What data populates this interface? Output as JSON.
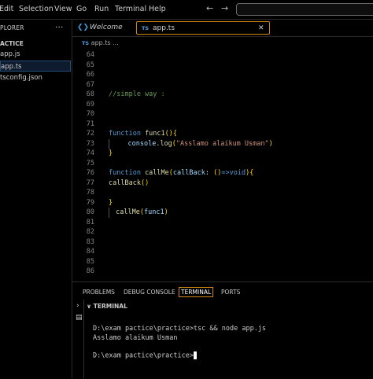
{
  "menubar": {
    "items": [
      "Edit",
      "Selection",
      "View",
      "Go",
      "Run",
      "Terminal",
      "Help"
    ],
    "back_icon": "arrow-left-icon",
    "forward_icon": "arrow-right-icon"
  },
  "explorer": {
    "header": "PLORER",
    "more": "···",
    "folder": "ACTICE",
    "files": [
      {
        "name": "app.js",
        "active": false
      },
      {
        "name": "app.ts",
        "active": true
      },
      {
        "name": "tsconfig.json",
        "active": false
      }
    ]
  },
  "tabs": {
    "welcome": {
      "icon": "vscode-icon",
      "label": "Welcome"
    },
    "app": {
      "icon_text": "TS",
      "label": "app.ts",
      "close": "✕"
    }
  },
  "breadcrumb": {
    "icon_text": "TS",
    "label": "app.ts",
    "more": "..."
  },
  "editor": {
    "lines": [
      {
        "n": "64",
        "tokens": []
      },
      {
        "n": "65",
        "tokens": []
      },
      {
        "n": "66",
        "tokens": []
      },
      {
        "n": "67",
        "tokens": []
      },
      {
        "n": "68",
        "tokens": [
          {
            "t": "//simple way :",
            "c": "comment"
          }
        ]
      },
      {
        "n": "69",
        "tokens": []
      },
      {
        "n": "70",
        "tokens": []
      },
      {
        "n": "71",
        "tokens": []
      },
      {
        "n": "72",
        "tokens": [
          {
            "t": "function ",
            "c": "kw"
          },
          {
            "t": "func1",
            "c": "fn"
          },
          {
            "t": "(){",
            "c": "par"
          }
        ]
      },
      {
        "n": "73",
        "guide": true,
        "tokens": [
          {
            "t": "    ",
            "c": "pl"
          },
          {
            "t": "console",
            "c": "var"
          },
          {
            "t": ".",
            "c": "pl"
          },
          {
            "t": "log",
            "c": "fn"
          },
          {
            "t": "(",
            "c": "par"
          },
          {
            "t": "\"Asslamo alaikum Usman\"",
            "c": "str"
          },
          {
            "t": ")",
            "c": "par"
          }
        ]
      },
      {
        "n": "74",
        "tokens": [
          {
            "t": "}",
            "c": "par"
          }
        ]
      },
      {
        "n": "75",
        "tokens": []
      },
      {
        "n": "76",
        "tokens": [
          {
            "t": "function ",
            "c": "kw"
          },
          {
            "t": "callMe",
            "c": "fn"
          },
          {
            "t": "(",
            "c": "par"
          },
          {
            "t": "callBack",
            "c": "var"
          },
          {
            "t": ": ",
            "c": "pl"
          },
          {
            "t": "()",
            "c": "par"
          },
          {
            "t": "=>",
            "c": "kw"
          },
          {
            "t": "void",
            "c": "kw"
          },
          {
            "t": "){",
            "c": "par"
          }
        ]
      },
      {
        "n": "77",
        "tokens": [
          {
            "t": "callBack",
            "c": "fn"
          },
          {
            "t": "()",
            "c": "par"
          }
        ]
      },
      {
        "n": "78",
        "tokens": []
      },
      {
        "n": "79",
        "tokens": [
          {
            "t": "}",
            "c": "par"
          }
        ]
      },
      {
        "n": "80",
        "guide": true,
        "tokens": [
          {
            "t": " ",
            "c": "pl"
          },
          {
            "t": "callMe",
            "c": "fn"
          },
          {
            "t": "(",
            "c": "par"
          },
          {
            "t": "func1",
            "c": "var"
          },
          {
            "t": ")",
            "c": "par"
          }
        ]
      },
      {
        "n": "81",
        "tokens": []
      },
      {
        "n": "82",
        "tokens": []
      },
      {
        "n": "83",
        "tokens": []
      },
      {
        "n": "84",
        "tokens": []
      },
      {
        "n": "85",
        "tokens": []
      },
      {
        "n": "86",
        "tokens": []
      }
    ]
  },
  "panel": {
    "tabs": [
      "PROBLEMS",
      "DEBUG CONSOLE",
      "TERMINAL",
      "PORTS"
    ],
    "active_tab": "TERMINAL",
    "terminal_header": "TERMINAL",
    "terminal_lines": [
      "D:\\exam pactice\\practice>tsc && node app.js",
      "Asslamo alaikum Usman",
      "",
      "D:\\exam pactice\\practice>"
    ]
  },
  "colors": {
    "accent_border": "#d18616",
    "keyword": "#569cd6",
    "function": "#dcdcaa",
    "string": "#ce9178",
    "comment": "#6a9955",
    "bracket": "#ffd700"
  }
}
